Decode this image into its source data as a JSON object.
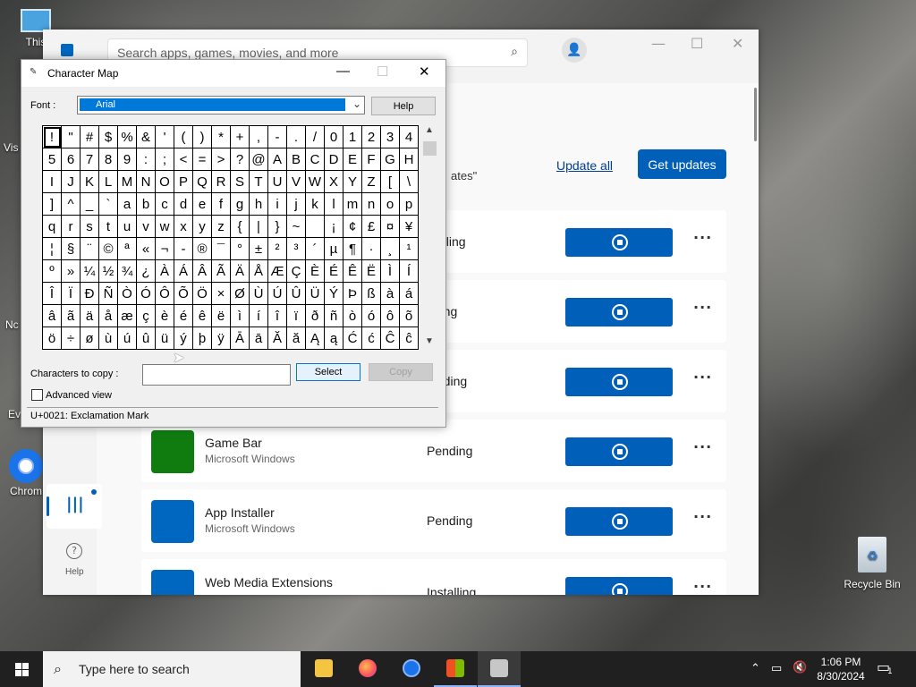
{
  "desktop": {
    "chrome_label": "Chrom",
    "recycle_bin_label": "Recycle Bin",
    "partial_left_labels": [
      "Vis",
      "Nc",
      "Ev"
    ],
    "this_pc_label": "This"
  },
  "store": {
    "search_placeholder": "Search apps, games, movies, and more",
    "update_all": "Update all",
    "get_updates": "Get updates",
    "partial_heading": "ates\"",
    "nav_help": "Help",
    "rows": [
      {
        "name": "",
        "publisher": "",
        "status": "stalling",
        "icon_color": "#0067c0"
      },
      {
        "name": "",
        "publisher": "",
        "status": "nding",
        "icon_color": "#0067c0"
      },
      {
        "name": "",
        "publisher": "",
        "status": "loading",
        "icon_color": "#0067c0"
      },
      {
        "name": "Game Bar",
        "publisher": "Microsoft Windows",
        "status": "Pending",
        "icon_color": "#107c10"
      },
      {
        "name": "App Installer",
        "publisher": "Microsoft Windows",
        "status": "Pending",
        "icon_color": "#0067c0"
      },
      {
        "name": "Web Media Extensions",
        "publisher": "",
        "status": "Installing",
        "icon_color": "#0067c0"
      }
    ]
  },
  "charmap": {
    "title": "Character Map",
    "font_label": "Font :",
    "font_value": "Arial",
    "help_button": "Help",
    "characters_to_copy_label": "Characters to copy :",
    "characters_to_copy_value": "",
    "select_button": "Select",
    "copy_button": "Copy",
    "advanced_view_label": "Advanced view",
    "advanced_view_checked": false,
    "status_text": "U+0021: Exclamation Mark",
    "selected_index": 0,
    "grid": [
      [
        "!",
        "\"",
        "#",
        "$",
        "%",
        "&",
        "'",
        "(",
        ")",
        "*",
        "+",
        ",",
        "-",
        ".",
        "/",
        "0",
        "1",
        "2",
        "3",
        "4"
      ],
      [
        "5",
        "6",
        "7",
        "8",
        "9",
        ":",
        ";",
        "<",
        "=",
        ">",
        "?",
        "@",
        "A",
        "B",
        "C",
        "D",
        "E",
        "F",
        "G",
        "H"
      ],
      [
        "I",
        "J",
        "K",
        "L",
        "M",
        "N",
        "O",
        "P",
        "Q",
        "R",
        "S",
        "T",
        "U",
        "V",
        "W",
        "X",
        "Y",
        "Z",
        "[",
        "\\"
      ],
      [
        "]",
        "^",
        "_",
        "`",
        "a",
        "b",
        "c",
        "d",
        "e",
        "f",
        "g",
        "h",
        "i",
        "j",
        "k",
        "l",
        "m",
        "n",
        "o",
        "p"
      ],
      [
        "q",
        "r",
        "s",
        "t",
        "u",
        "v",
        "w",
        "x",
        "y",
        "z",
        "{",
        "|",
        "}",
        "~",
        " ",
        "¡",
        "¢",
        "£",
        "¤",
        "¥"
      ],
      [
        "¦",
        "§",
        "¨",
        "©",
        "ª",
        "«",
        "¬",
        "-",
        "®",
        "¯",
        "°",
        "±",
        "²",
        "³",
        "´",
        "µ",
        "¶",
        "·",
        "¸",
        "¹"
      ],
      [
        "º",
        "»",
        "¼",
        "½",
        "¾",
        "¿",
        "À",
        "Á",
        "Â",
        "Ã",
        "Ä",
        "Å",
        "Æ",
        "Ç",
        "È",
        "É",
        "Ê",
        "Ë",
        "Ì",
        "Í"
      ],
      [
        "Î",
        "Ï",
        "Ð",
        "Ñ",
        "Ò",
        "Ó",
        "Ô",
        "Õ",
        "Ö",
        "×",
        "Ø",
        "Ù",
        "Ú",
        "Û",
        "Ü",
        "Ý",
        "Þ",
        "ß",
        "à",
        "á"
      ],
      [
        "â",
        "ã",
        "ä",
        "å",
        "æ",
        "ç",
        "è",
        "é",
        "ê",
        "ë",
        "ì",
        "í",
        "î",
        "ï",
        "ð",
        "ñ",
        "ò",
        "ó",
        "ô",
        "õ"
      ],
      [
        "ö",
        "÷",
        "ø",
        "ù",
        "ú",
        "û",
        "ü",
        "ý",
        "þ",
        "ÿ",
        "Ā",
        "ā",
        "Ă",
        "ă",
        "Ą",
        "ą",
        "Ć",
        "ć",
        "Ĉ",
        "ĉ"
      ]
    ]
  },
  "taskbar": {
    "search_placeholder": "Type here to search",
    "time": "1:06 PM",
    "date": "8/30/2024",
    "notification_count": "1"
  }
}
